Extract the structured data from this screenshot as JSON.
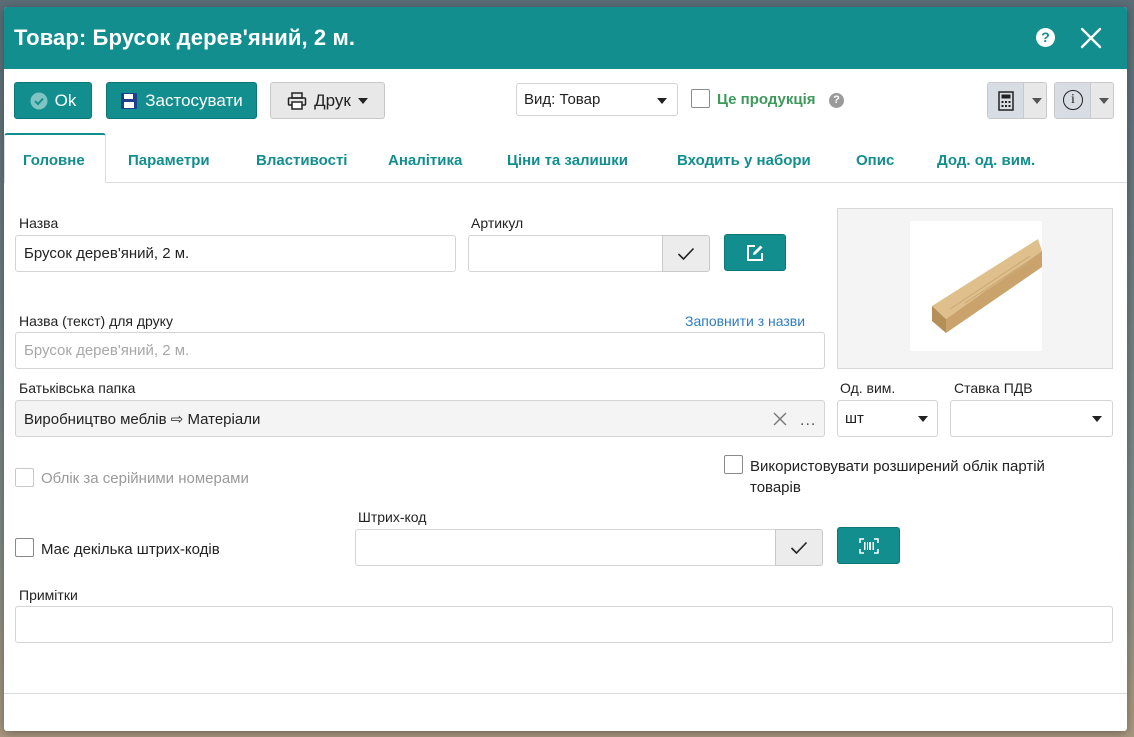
{
  "window": {
    "title": "Товар: Брусок дерев'яний, 2 м.",
    "help_glyph": "?"
  },
  "toolbar": {
    "ok_label": "Ok",
    "apply_label": "Застосувати",
    "print_label": "Друк",
    "view_select_value": "Вид: Товар",
    "is_product_label": "Це продукція",
    "is_product_checked": false,
    "info_glyph": "i"
  },
  "tabs": [
    {
      "label": "Головне",
      "active": true
    },
    {
      "label": "Параметри"
    },
    {
      "label": "Властивості"
    },
    {
      "label": "Аналітика"
    },
    {
      "label": "Ціни та залишки"
    },
    {
      "label": "Входить у набори"
    },
    {
      "label": "Опис"
    },
    {
      "label": "Дод. од. вим."
    }
  ],
  "form": {
    "name_label": "Назва",
    "name_value": "Брусок дерев'яний, 2 м.",
    "article_label": "Артикул",
    "article_value": "",
    "print_name_label": "Назва (текст) для друку",
    "fill_from_name_link": "Заповнити з назви",
    "print_name_placeholder": "Брусок дерев'яний, 2 м.",
    "parent_folder_label": "Батьківська папка",
    "parent_folder_value": "Виробництво меблів ⇨ Матеріали",
    "unit_label": "Од. вим.",
    "unit_value": "шт",
    "vat_label": "Ставка ПДВ",
    "vat_value": "",
    "serial_label": "Облік за серійними номерами",
    "serial_checked": false,
    "batch_label_line1": "Використовувати розширений облік партій",
    "batch_label_line2": "товарів",
    "batch_checked": false,
    "barcode_label": "Штрих-код",
    "barcode_value": "",
    "multi_barcode_label": "Має декілька штрих-кодів",
    "multi_barcode_checked": false,
    "notes_label": "Примітки",
    "notes_value": ""
  },
  "colors": {
    "accent": "#128e8e",
    "link": "#2f7cc1",
    "accent_text": "#3d9a5a"
  }
}
